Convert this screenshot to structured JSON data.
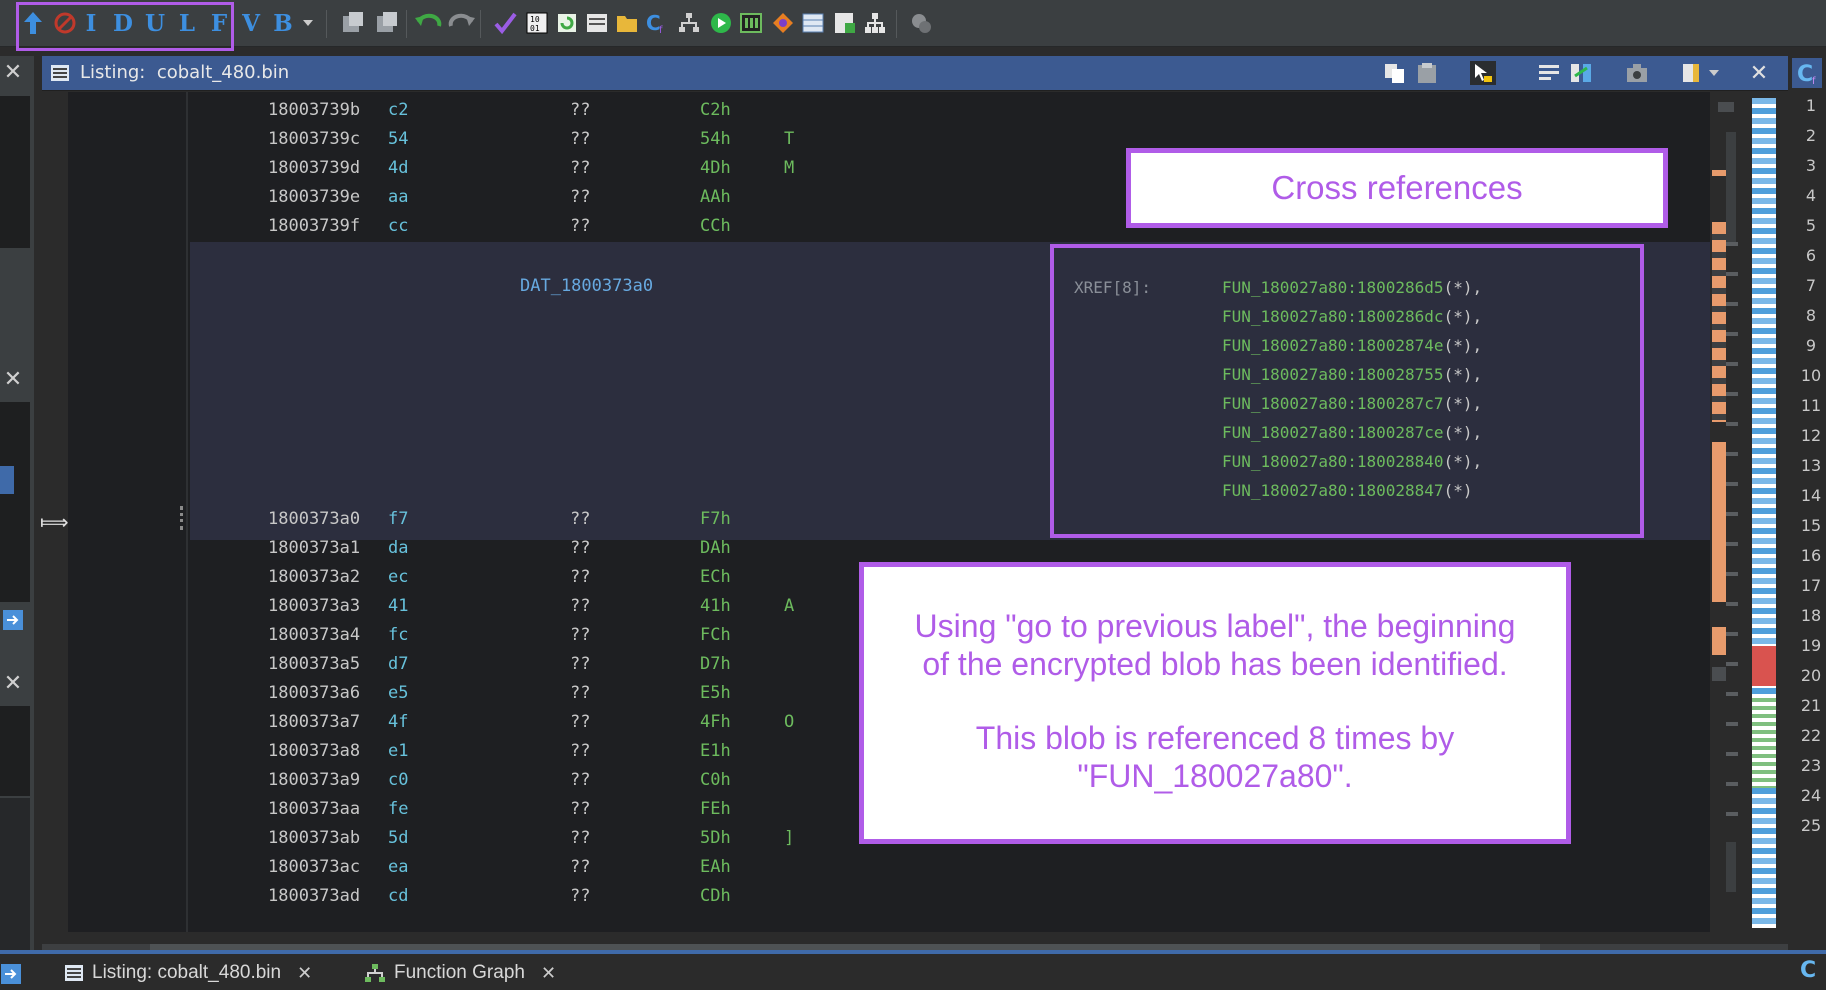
{
  "toolbar": {
    "nav_letters": [
      "I",
      "D",
      "U",
      "L",
      "F",
      "V",
      "B"
    ]
  },
  "listing": {
    "title_prefix": "Listing:",
    "title_file": "cobalt_480.bin",
    "rows_before": [
      {
        "addr": "18003739b",
        "byte": "c2",
        "mnem": "??",
        "val": "C2h",
        "chr": ""
      },
      {
        "addr": "18003739c",
        "byte": "54",
        "mnem": "??",
        "val": "54h",
        "chr": "T"
      },
      {
        "addr": "18003739d",
        "byte": "4d",
        "mnem": "??",
        "val": "4Dh",
        "chr": "M"
      },
      {
        "addr": "18003739e",
        "byte": "aa",
        "mnem": "??",
        "val": "AAh",
        "chr": ""
      },
      {
        "addr": "18003739f",
        "byte": "cc",
        "mnem": "??",
        "val": "CCh",
        "chr": ""
      }
    ],
    "label": "DAT_1800373a0",
    "label_row": {
      "addr": "1800373a0",
      "byte": "f7",
      "mnem": "??",
      "val": "F7h",
      "chr": ""
    },
    "rows_after": [
      {
        "addr": "1800373a1",
        "byte": "da",
        "mnem": "??",
        "val": "DAh",
        "chr": ""
      },
      {
        "addr": "1800373a2",
        "byte": "ec",
        "mnem": "??",
        "val": "ECh",
        "chr": ""
      },
      {
        "addr": "1800373a3",
        "byte": "41",
        "mnem": "??",
        "val": "41h",
        "chr": "A"
      },
      {
        "addr": "1800373a4",
        "byte": "fc",
        "mnem": "??",
        "val": "FCh",
        "chr": ""
      },
      {
        "addr": "1800373a5",
        "byte": "d7",
        "mnem": "??",
        "val": "D7h",
        "chr": ""
      },
      {
        "addr": "1800373a6",
        "byte": "e5",
        "mnem": "??",
        "val": "E5h",
        "chr": ""
      },
      {
        "addr": "1800373a7",
        "byte": "4f",
        "mnem": "??",
        "val": "4Fh",
        "chr": "O"
      },
      {
        "addr": "1800373a8",
        "byte": "e1",
        "mnem": "??",
        "val": "E1h",
        "chr": ""
      },
      {
        "addr": "1800373a9",
        "byte": "c0",
        "mnem": "??",
        "val": "C0h",
        "chr": ""
      },
      {
        "addr": "1800373aa",
        "byte": "fe",
        "mnem": "??",
        "val": "FEh",
        "chr": ""
      },
      {
        "addr": "1800373ab",
        "byte": "5d",
        "mnem": "??",
        "val": "5Dh",
        "chr": "]"
      },
      {
        "addr": "1800373ac",
        "byte": "ea",
        "mnem": "??",
        "val": "EAh",
        "chr": ""
      },
      {
        "addr": "1800373ad",
        "byte": "cd",
        "mnem": "??",
        "val": "CDh",
        "chr": ""
      }
    ],
    "xref_label": "XREF[8]:",
    "xrefs": [
      {
        "ref": "FUN_180027a80:1800286d5",
        "tail": "(*),"
      },
      {
        "ref": "FUN_180027a80:1800286dc",
        "tail": "(*),"
      },
      {
        "ref": "FUN_180027a80:18002874e",
        "tail": "(*),"
      },
      {
        "ref": "FUN_180027a80:180028755",
        "tail": "(*),"
      },
      {
        "ref": "FUN_180027a80:1800287c7",
        "tail": "(*),"
      },
      {
        "ref": "FUN_180027a80:1800287ce",
        "tail": "(*),"
      },
      {
        "ref": "FUN_180027a80:180028840",
        "tail": "(*),"
      },
      {
        "ref": "FUN_180027a80:180028847",
        "tail": "(*)"
      }
    ]
  },
  "annotations": {
    "xref_title": "Cross references",
    "note_line1": "Using \"go to previous label\", the beginning",
    "note_line2": "of the encrypted blob has been identified.",
    "note_line3": "This blob is referenced 8 times by",
    "note_line4": "\"FUN_180027a80\"."
  },
  "line_numbers": [
    "1",
    "2",
    "3",
    "4",
    "5",
    "6",
    "7",
    "8",
    "9",
    "10",
    "11",
    "12",
    "13",
    "14",
    "15",
    "16",
    "17",
    "18",
    "19",
    "20",
    "21",
    "22",
    "23",
    "24",
    "25"
  ],
  "bottom_tabs": {
    "listing_tab": "Listing:  cobalt_480.bin",
    "graph_tab": "Function Graph"
  },
  "colors": {
    "highlight": "#b05ce8",
    "header_blue": "#3c5a91",
    "address_text": "#c8c8c8",
    "byte_text": "#67c1db",
    "value_text": "#6dbb5e"
  }
}
